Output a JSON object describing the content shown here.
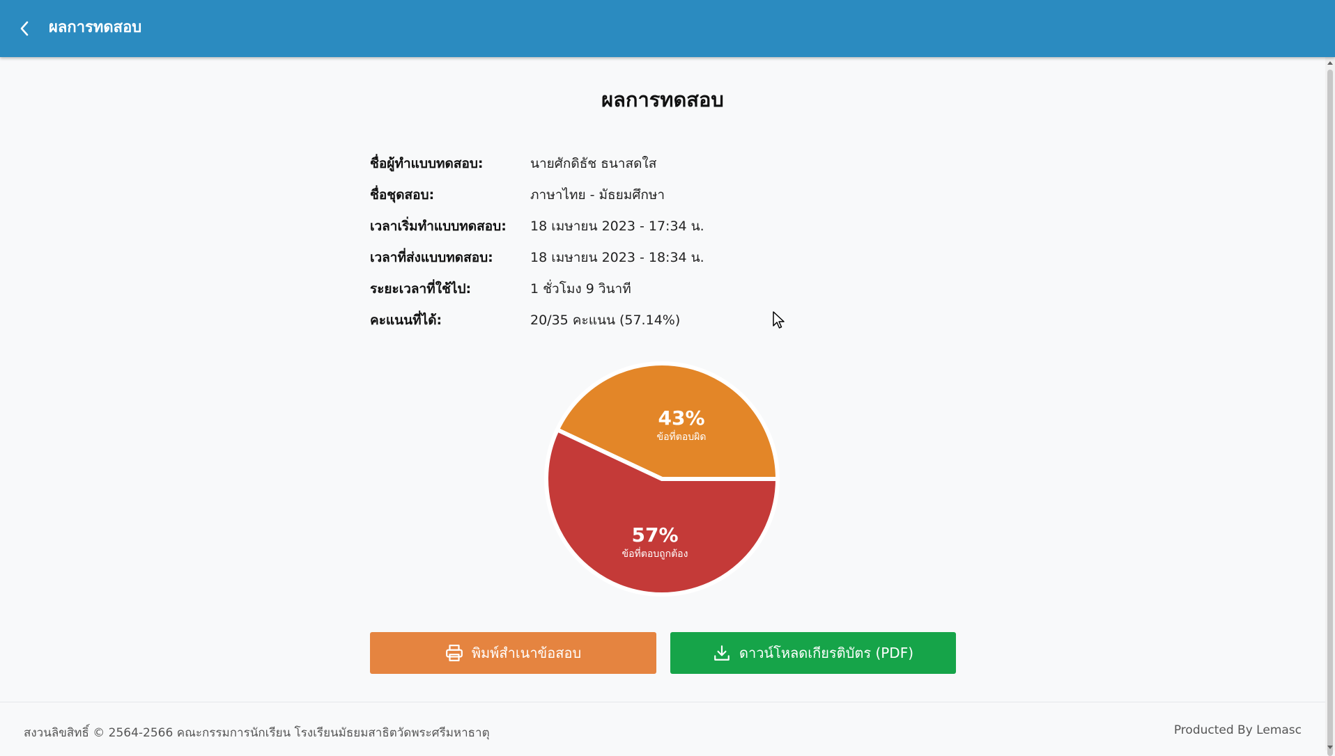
{
  "appbar": {
    "title": "ผลการทดสอบ",
    "back_icon": "chevron-left-icon"
  },
  "page_title": "ผลการทดสอบ",
  "info": [
    {
      "label": "ชื่อผู้ทำแบบทดสอบ:",
      "value": "นายศักดิธัช ธนาสดใส"
    },
    {
      "label": "ชื่อชุดสอบ:",
      "value": "ภาษาไทย - มัธยมศึกษา"
    },
    {
      "label": "เวลาเริ่มทำแบบทดสอบ:",
      "value": "18 เมษายน 2023 - 17:34 น."
    },
    {
      "label": "เวลาที่ส่งแบบทดสอบ:",
      "value": "18 เมษายน 2023 - 18:34 น."
    },
    {
      "label": "ระยะเวลาที่ใช้ไป:",
      "value": "1 ชั่วโมง 9 วินาที"
    },
    {
      "label": "คะแนนที่ได้:",
      "value": "20/35 คะแนน (57.14%)"
    }
  ],
  "chart_data": {
    "type": "pie",
    "slices": [
      {
        "label": "ข้อที่ตอบผิด",
        "percent_label": "43%",
        "value": 43,
        "color": "#e38628"
      },
      {
        "label": "ข้อที่ตอบถูกต้อง",
        "percent_label": "57%",
        "value": 57,
        "color": "#c43a38"
      }
    ]
  },
  "buttons": {
    "print": {
      "label": "พิมพ์สำเนาข้อสอบ",
      "icon": "printer-icon",
      "color": "#e58440"
    },
    "download": {
      "label": "ดาวน์โหลดเกียรติบัตร (PDF)",
      "icon": "download-icon",
      "color": "#16a449"
    }
  },
  "footer": {
    "copyright": "สงวนลิขสิทธิ์ © 2564-2566 คณะกรรมการนักเรียน โรงเรียนมัธยมสาธิตวัดพระศรีมหาธาตุ",
    "producer": "Producted By Lemasc"
  },
  "colors": {
    "appbar": "#2b8bc0",
    "background": "#f8f9fa"
  }
}
